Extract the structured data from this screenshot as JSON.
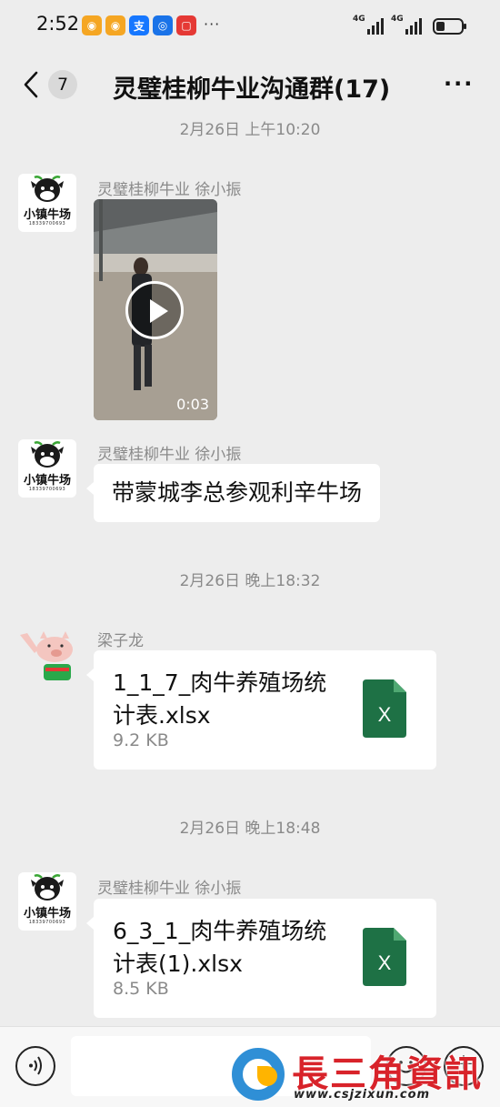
{
  "status_bar": {
    "time": "2:52",
    "app_icons": [
      {
        "name": "weibo-icon",
        "color": "#f5a623",
        "glyph": "◉"
      },
      {
        "name": "weibo-icon",
        "color": "#f5a623",
        "glyph": "◉"
      },
      {
        "name": "alipay-icon",
        "color": "#1677ff",
        "glyph": "支"
      },
      {
        "name": "browser-icon",
        "color": "#1a73e8",
        "glyph": "◎"
      },
      {
        "name": "app-icon",
        "color": "#e53935",
        "glyph": "▢"
      }
    ],
    "more_glyph": "···",
    "network_1": "4G",
    "network_2": "4G",
    "battery_percent": 35
  },
  "header": {
    "unread_count": "7",
    "title": "灵璧桂柳牛业沟通群(17)",
    "more_glyph": "···"
  },
  "messages": [
    {
      "timestamp": "2月26日 上午10:20"
    },
    {
      "sender": "灵璧桂柳牛业   徐小振",
      "avatar_text": "小镇牛场",
      "avatar_phone": "18339700693",
      "video_duration": "0:03"
    },
    {
      "sender": "灵璧桂柳牛业   徐小振",
      "avatar_text": "小镇牛场",
      "avatar_phone": "18339700693",
      "text": "带蒙城李总参观利辛牛场"
    },
    {
      "timestamp": "2月26日 晚上18:32"
    },
    {
      "sender": "梁子龙",
      "file_name": "1_1_7_肉牛养殖场统计表.xlsx",
      "file_size": "9.2 KB",
      "file_icon_label": "X"
    },
    {
      "timestamp": "2月26日 晚上18:48"
    },
    {
      "sender": "灵璧桂柳牛业   徐小振",
      "avatar_text": "小镇牛场",
      "avatar_phone": "18339700693",
      "file_name": "6_3_1_肉牛养殖场统计表(1).xlsx",
      "file_size": "8.5 KB",
      "file_icon_label": "X"
    }
  ],
  "input_bar": {
    "plus_label": "+"
  },
  "watermark": {
    "title": "長三角資訊",
    "url": "www.csjzixun.com"
  }
}
